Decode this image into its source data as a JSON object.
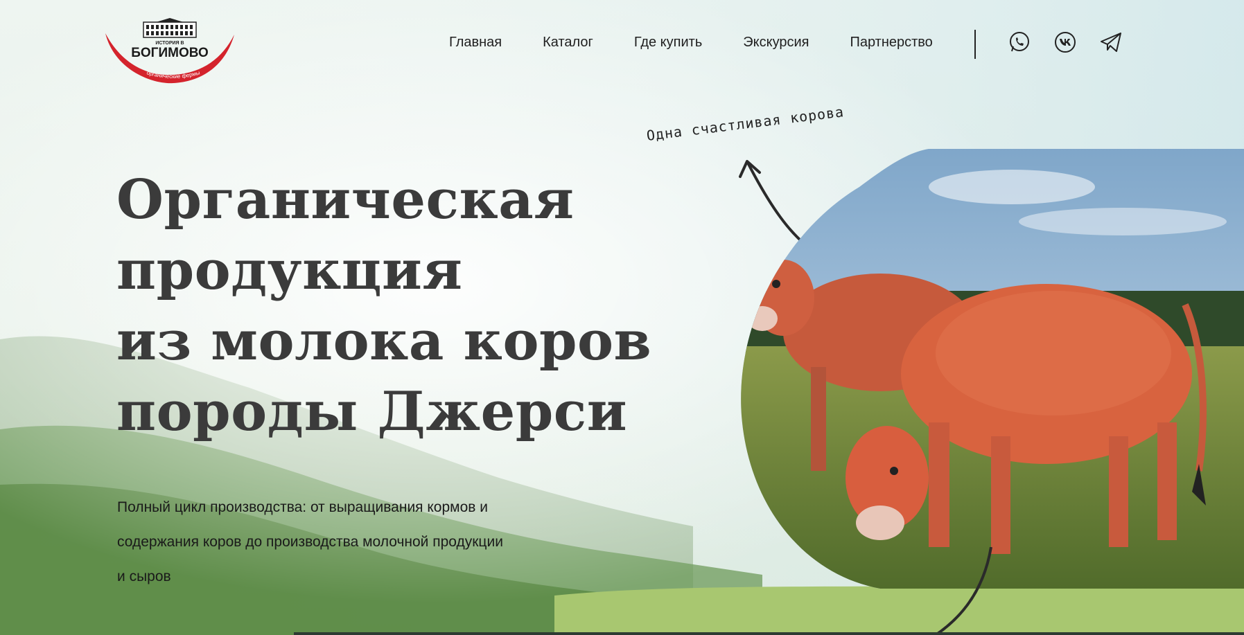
{
  "logo": {
    "top_text": "ИСТОРИЯ В",
    "name": "БОГИМОВО",
    "tagline": "органические фермы",
    "accent_color": "#d4232c"
  },
  "nav": {
    "items": [
      {
        "label": "Главная"
      },
      {
        "label": "Каталог"
      },
      {
        "label": "Где купить"
      },
      {
        "label": "Экскурсия"
      },
      {
        "label": "Партнерство"
      }
    ]
  },
  "social": [
    {
      "icon": "whatsapp-icon"
    },
    {
      "icon": "vk-icon"
    },
    {
      "icon": "telegram-icon"
    }
  ],
  "hero": {
    "title_lines": [
      "Органическая",
      "продукция",
      "из молока коров",
      "породы Джерси"
    ],
    "description_lines": [
      "Полный цикл производства: от выращивания кормов и",
      "содержания коров до производства молочной продукции",
      "и сыров"
    ],
    "annotation": "Одна счастливая корова"
  },
  "colors": {
    "text_dark": "#3b3b3b",
    "cow_color": "#d8633f",
    "brand_red": "#d4232c"
  }
}
